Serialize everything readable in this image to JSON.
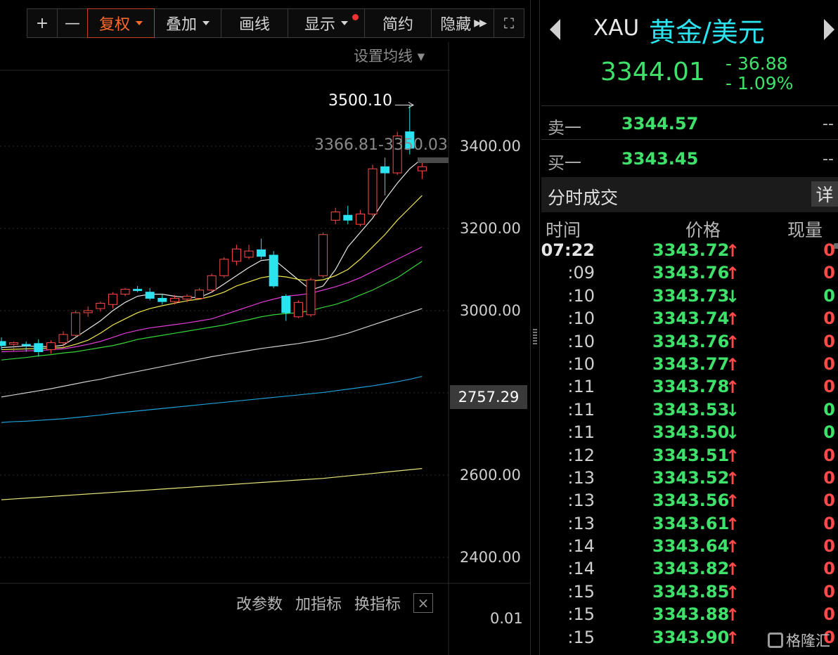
{
  "toolbar": {
    "zoom_in": "+",
    "zoom_out": "—",
    "adjust": "复权",
    "overlay": "叠加",
    "draw": "画线",
    "display": "显示",
    "simple": "简约",
    "hide": "隐藏",
    "hide_arrows": "▶▶",
    "fullscreen": "⛶"
  },
  "chart": {
    "set_ma_label": "设置均线 ▾",
    "y_ticks": [
      "3400.00",
      "3200.00",
      "3000.00",
      "2600.00",
      "2400.00"
    ],
    "current_price_tag": "2757.29",
    "high_label": "3500.10",
    "range_label": "3366.81-3350.03",
    "indicator_buttons": [
      "改参数",
      "加指标",
      "换指标"
    ],
    "indicator_close": "×",
    "indicator_value": "0.01",
    "colors": {
      "up": "#ff4a4a",
      "down": "#2be2ef",
      "ma5": "#e6e6e6",
      "ma10": "#f2e94e",
      "ma20": "#e23bd8",
      "ma30": "#36d63a",
      "ma60": "#cfcfcf",
      "ma120": "#1f9fd8",
      "ma250": "#e8e67a"
    }
  },
  "chart_data": {
    "type": "candlestick",
    "y_range": [
      2300,
      3550
    ],
    "candles": [
      {
        "o": 2925,
        "h": 2935,
        "l": 2905,
        "c": 2915
      },
      {
        "o": 2918,
        "h": 2925,
        "l": 2900,
        "c": 2922
      },
      {
        "o": 2918,
        "h": 2925,
        "l": 2900,
        "c": 2915
      },
      {
        "o": 2920,
        "h": 2930,
        "l": 2888,
        "c": 2900
      },
      {
        "o": 2905,
        "h": 2928,
        "l": 2895,
        "c": 2922
      },
      {
        "o": 2922,
        "h": 2950,
        "l": 2910,
        "c": 2942
      },
      {
        "o": 2940,
        "h": 3000,
        "l": 2935,
        "c": 2995
      },
      {
        "o": 2995,
        "h": 3010,
        "l": 2985,
        "c": 3000
      },
      {
        "o": 3005,
        "h": 3022,
        "l": 2998,
        "c": 3018
      },
      {
        "o": 3015,
        "h": 3045,
        "l": 3005,
        "c": 3040
      },
      {
        "o": 3040,
        "h": 3055,
        "l": 3035,
        "c": 3052
      },
      {
        "o": 3052,
        "h": 3060,
        "l": 3045,
        "c": 3050
      },
      {
        "o": 3045,
        "h": 3055,
        "l": 3025,
        "c": 3030
      },
      {
        "o": 3030,
        "h": 3040,
        "l": 3015,
        "c": 3022
      },
      {
        "o": 3022,
        "h": 3038,
        "l": 3015,
        "c": 3030
      },
      {
        "o": 3028,
        "h": 3040,
        "l": 3020,
        "c": 3035
      },
      {
        "o": 3030,
        "h": 3055,
        "l": 3028,
        "c": 3050
      },
      {
        "o": 3050,
        "h": 3090,
        "l": 3045,
        "c": 3085
      },
      {
        "o": 3085,
        "h": 3130,
        "l": 3080,
        "c": 3125
      },
      {
        "o": 3120,
        "h": 3160,
        "l": 3110,
        "c": 3150
      },
      {
        "o": 3130,
        "h": 3160,
        "l": 3125,
        "c": 3145
      },
      {
        "o": 3148,
        "h": 3175,
        "l": 3125,
        "c": 3132
      },
      {
        "o": 3135,
        "h": 3145,
        "l": 3055,
        "c": 3060
      },
      {
        "o": 3035,
        "h": 3040,
        "l": 2975,
        "c": 2995
      },
      {
        "o": 2985,
        "h": 3025,
        "l": 2982,
        "c": 3020
      },
      {
        "o": 2990,
        "h": 3080,
        "l": 2985,
        "c": 3075
      },
      {
        "o": 3085,
        "h": 3190,
        "l": 3080,
        "c": 3185
      },
      {
        "o": 3220,
        "h": 3250,
        "l": 3210,
        "c": 3240
      },
      {
        "o": 3232,
        "h": 3255,
        "l": 3210,
        "c": 3220
      },
      {
        "o": 3210,
        "h": 3245,
        "l": 3205,
        "c": 3235
      },
      {
        "o": 3235,
        "h": 3355,
        "l": 3230,
        "c": 3345
      },
      {
        "o": 3350,
        "h": 3372,
        "l": 3280,
        "c": 3335
      },
      {
        "o": 3335,
        "h": 3435,
        "l": 3330,
        "c": 3425
      },
      {
        "o": 3435,
        "h": 3500.1,
        "l": 3380,
        "c": 3395
      },
      {
        "o": 3340,
        "h": 3368,
        "l": 3320,
        "c": 3350
      }
    ],
    "moving_averages": [
      {
        "name": "MA5",
        "values": [
          2910,
          2912,
          2914,
          2913,
          2912,
          2916,
          2935,
          2955,
          2975,
          3000,
          3020,
          3035,
          3040,
          3040,
          3035,
          3032,
          3032,
          3045,
          3065,
          3085,
          3105,
          3122,
          3125,
          3100,
          3075,
          3050,
          3060,
          3100,
          3155,
          3190,
          3225,
          3270,
          3310,
          3345,
          3370
        ]
      },
      {
        "name": "MA10",
        "values": [
          2905,
          2906,
          2907,
          2908,
          2909,
          2910,
          2918,
          2928,
          2945,
          2965,
          2980,
          2995,
          3005,
          3012,
          3018,
          3024,
          3028,
          3035,
          3045,
          3060,
          3070,
          3080,
          3085,
          3082,
          3076,
          3072,
          3075,
          3085,
          3100,
          3125,
          3155,
          3185,
          3220,
          3250,
          3280
        ]
      },
      {
        "name": "MA20",
        "values": [
          2900,
          2901,
          2902,
          2903,
          2905,
          2907,
          2912,
          2918,
          2925,
          2935,
          2945,
          2952,
          2958,
          2962,
          2966,
          2970,
          2975,
          2980,
          2990,
          3000,
          3010,
          3020,
          3028,
          3035,
          3038,
          3042,
          3050,
          3058,
          3068,
          3080,
          3095,
          3110,
          3125,
          3140,
          3155
        ]
      },
      {
        "name": "MA30",
        "values": [
          2880,
          2883,
          2886,
          2890,
          2893,
          2897,
          2900,
          2905,
          2910,
          2915,
          2922,
          2930,
          2935,
          2940,
          2945,
          2950,
          2955,
          2960,
          2965,
          2972,
          2978,
          2985,
          2990,
          2993,
          2995,
          3000,
          3008,
          3015,
          3025,
          3038,
          3050,
          3065,
          3080,
          3100,
          3120
        ]
      },
      {
        "name": "MA60",
        "values": [
          2790,
          2795,
          2800,
          2805,
          2810,
          2816,
          2822,
          2828,
          2833,
          2840,
          2846,
          2852,
          2858,
          2864,
          2870,
          2876,
          2882,
          2888,
          2893,
          2898,
          2903,
          2908,
          2912,
          2916,
          2920,
          2925,
          2930,
          2937,
          2945,
          2955,
          2965,
          2975,
          2985,
          2995,
          3005
        ]
      },
      {
        "name": "MA120",
        "values": [
          2728,
          2730,
          2731,
          2733,
          2735,
          2737,
          2740,
          2743,
          2746,
          2750,
          2753,
          2756,
          2759,
          2762,
          2765,
          2768,
          2771,
          2774,
          2777,
          2780,
          2783,
          2786,
          2789,
          2792,
          2795,
          2798,
          2801,
          2805,
          2809,
          2813,
          2817,
          2822,
          2827,
          2833,
          2840
        ]
      },
      {
        "name": "MA250",
        "values": [
          2540,
          2542,
          2544,
          2546,
          2548,
          2550,
          2552,
          2554,
          2556,
          2558,
          2560,
          2562,
          2564,
          2566,
          2568,
          2570,
          2572,
          2574,
          2576,
          2578,
          2580,
          2582,
          2584,
          2586,
          2588,
          2590,
          2592,
          2595,
          2598,
          2601,
          2604,
          2607,
          2610,
          2613,
          2616
        ]
      }
    ]
  },
  "quote": {
    "code": "XAU",
    "name": "黄金/美元",
    "last": "3344.01",
    "change": "- 36.88",
    "change_pct": "- 1.09%",
    "ask_label": "卖一",
    "ask": "3344.57",
    "bid_label": "买一",
    "bid": "3343.45",
    "placeholder": "--"
  },
  "tape": {
    "title": "分时成交",
    "detail": "详",
    "headers": [
      "时间",
      "价格",
      "现量"
    ],
    "rows": [
      {
        "time": "07:22",
        "price": "3343.72",
        "dir": "up",
        "vol": "0"
      },
      {
        "time": ":09",
        "price": "3343.76",
        "dir": "up",
        "vol": "0"
      },
      {
        "time": ":10",
        "price": "3343.73",
        "dir": "dn",
        "vol": "0"
      },
      {
        "time": ":10",
        "price": "3343.74",
        "dir": "up",
        "vol": "0"
      },
      {
        "time": ":10",
        "price": "3343.76",
        "dir": "up",
        "vol": "0"
      },
      {
        "time": ":10",
        "price": "3343.77",
        "dir": "up",
        "vol": "0"
      },
      {
        "time": ":11",
        "price": "3343.78",
        "dir": "up",
        "vol": "0"
      },
      {
        "time": ":11",
        "price": "3343.53",
        "dir": "dn",
        "vol": "0"
      },
      {
        "time": ":11",
        "price": "3343.50",
        "dir": "dn",
        "vol": "0"
      },
      {
        "time": ":12",
        "price": "3343.51",
        "dir": "up",
        "vol": "0"
      },
      {
        "time": ":13",
        "price": "3343.52",
        "dir": "up",
        "vol": "0"
      },
      {
        "time": ":13",
        "price": "3343.56",
        "dir": "up",
        "vol": "0"
      },
      {
        "time": ":13",
        "price": "3343.61",
        "dir": "up",
        "vol": "0"
      },
      {
        "time": ":14",
        "price": "3343.64",
        "dir": "up",
        "vol": "0"
      },
      {
        "time": ":14",
        "price": "3343.82",
        "dir": "up",
        "vol": "0"
      },
      {
        "time": ":15",
        "price": "3343.85",
        "dir": "up",
        "vol": "0"
      },
      {
        "time": ":15",
        "price": "3343.88",
        "dir": "up",
        "vol": "0"
      },
      {
        "time": ":15",
        "price": "3343.90",
        "dir": "up",
        "vol": "0"
      }
    ]
  },
  "watermark": "格隆汇"
}
